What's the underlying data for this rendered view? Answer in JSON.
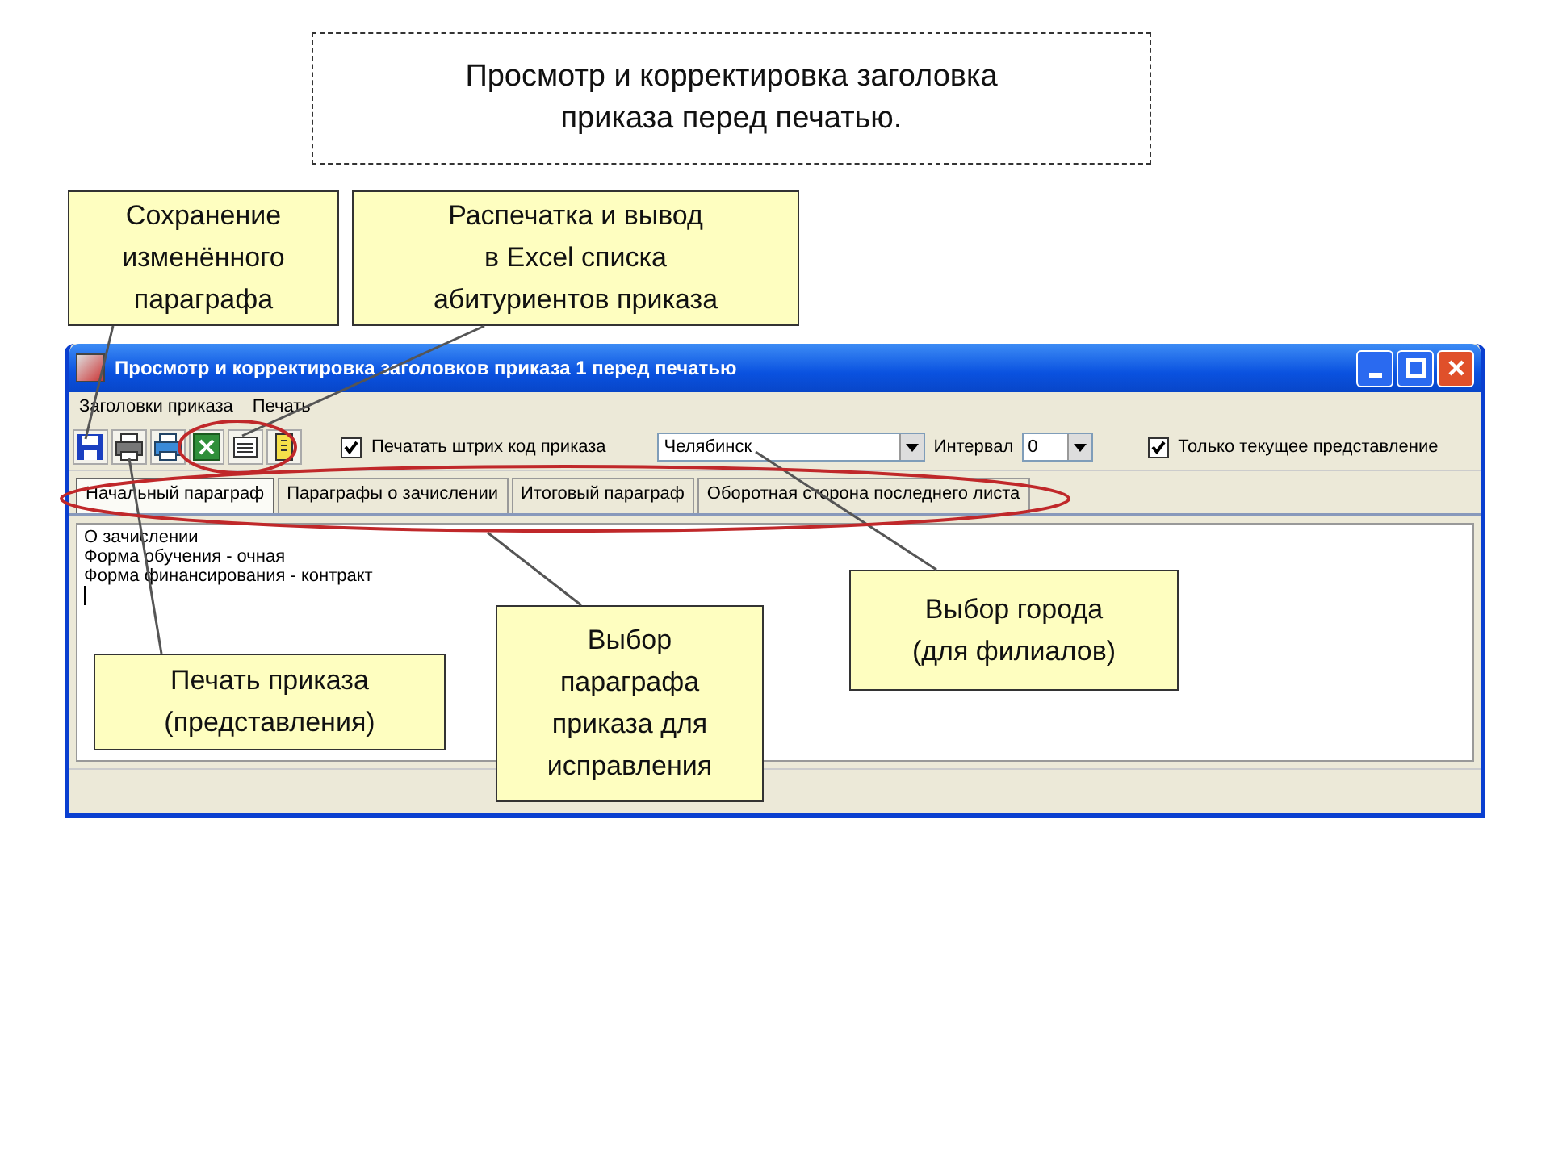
{
  "slide_title": "Просмотр и корректировка заголовка\nприказа перед печатью.",
  "window": {
    "title": "Просмотр и корректировка заголовков приказа 1 перед печатью",
    "menu": [
      "Заголовки приказа",
      "Печать"
    ],
    "toolbar": {
      "barcode_checkbox": {
        "label": "Печатать штрих код приказа",
        "checked": true
      },
      "city": "Челябинск",
      "interval_label": "Интервал",
      "interval": "0",
      "current_checkbox": {
        "label": "Только текущее представление",
        "checked": true
      }
    },
    "tabs": [
      {
        "label": "Начальный параграф",
        "selected": true
      },
      {
        "label": "Параграфы о зачислении",
        "selected": false
      },
      {
        "label": "Итоговый параграф",
        "selected": false
      },
      {
        "label": "Оборотная сторона последнего листа",
        "selected": false
      }
    ],
    "content_lines": [
      "О зачислении",
      "Форма обучения - очная",
      "Форма финансирования - контракт"
    ]
  },
  "callouts": [
    {
      "text": "Сохранение\nизменённого\nпараграфа"
    },
    {
      "text": "Распечатка и вывод\nв Excel списка\nабитуриентов приказа"
    },
    {
      "text": "Печать приказа\n(представления)"
    },
    {
      "text": "Выбор\nпараграфа\nприказа для\nисправления"
    },
    {
      "text": "Выбор города\n(для филиалов)"
    }
  ]
}
